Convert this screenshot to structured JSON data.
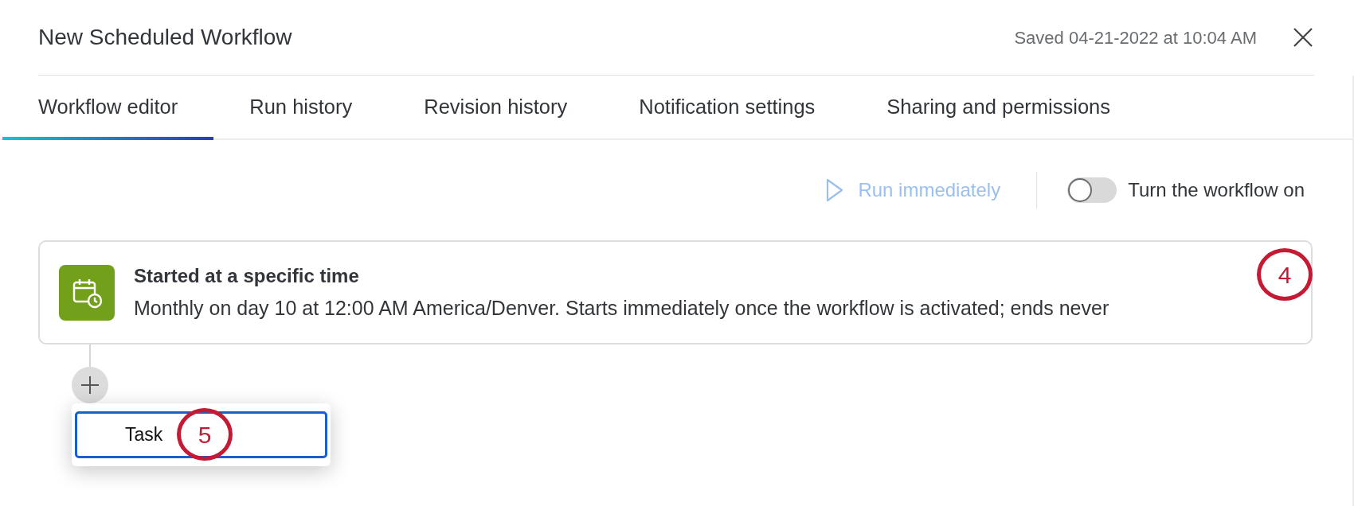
{
  "dialog": {
    "title": "New Scheduled Workflow",
    "saved_status": "Saved 04-21-2022 at 10:04 AM"
  },
  "tabs": [
    {
      "label": "Workflow editor",
      "selected": true
    },
    {
      "label": "Run history",
      "selected": false
    },
    {
      "label": "Revision history",
      "selected": false
    },
    {
      "label": "Notification settings",
      "selected": false
    },
    {
      "label": "Sharing and permissions",
      "selected": false
    }
  ],
  "toolbar": {
    "run_button": {
      "label": "Run immediately",
      "disabled": true
    },
    "toggle": {
      "label": "Turn the workflow on",
      "on": false
    }
  },
  "trigger_card": {
    "title": "Started at a specific time",
    "description": "Monthly on day 10 at 12:00 AM America/Denver. Starts immediately once the workflow is activated; ends never",
    "callout": "4"
  },
  "add_menu": {
    "items": [
      {
        "label": "Task",
        "selected": true,
        "callout": "5"
      }
    ]
  }
}
